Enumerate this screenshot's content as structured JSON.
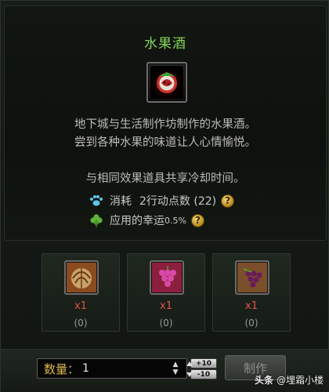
{
  "item": {
    "title": "水果酒",
    "icon": "fruit-wine-icon",
    "description_lines": [
      "地下城与生活制作坊制作的水果酒。",
      "尝到各种水果的味道让人心情愉悦。",
      "与相同效果道具共享冷却时间。"
    ],
    "cost_label": "消耗",
    "cost_value": "2行动点数 (22)",
    "luck_label": "应用的幸运",
    "luck_value": "0.5%"
  },
  "materials": [
    {
      "icon": "melon-icon",
      "qty": "x1",
      "have": "(0)"
    },
    {
      "icon": "grape-icon",
      "qty": "x1",
      "have": "(0)"
    },
    {
      "icon": "berry-cluster-icon",
      "qty": "x1",
      "have": "(0)"
    }
  ],
  "craft": {
    "qty_label": "数量：",
    "qty_value": "1",
    "plus_ten": "+10",
    "minus_ten": "-10",
    "make_label": "制作"
  },
  "watermark": {
    "head": "头条",
    "handle": "@埋霜小楼"
  },
  "colors": {
    "title_green": "#86d35a",
    "qty_red": "#e2524a",
    "help_gold": "#d7a83a"
  }
}
